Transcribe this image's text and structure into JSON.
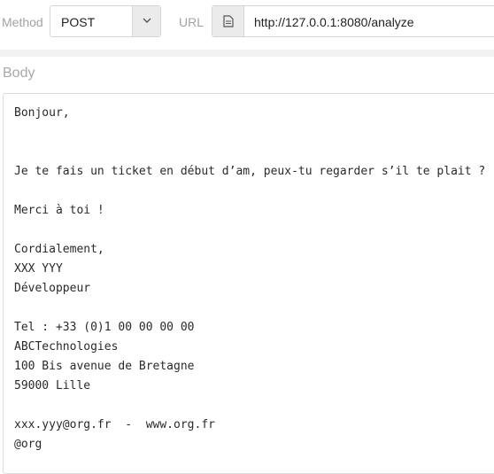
{
  "request": {
    "method_label": "Method",
    "method_value": "POST",
    "url_label": "URL",
    "url_value": "http://127.0.0.1:8080/analyze"
  },
  "body": {
    "label": "Body",
    "text": "Bonjour,\n\n\nJe te fais un ticket en début d’am, peux-tu regarder s’il te plait ?\n\nMerci à toi !\n\nCordialement,\nXXX YYY\nDéveloppeur\n\nTel : +33 (0)1 00 00 00 00\nABCTechnologies\n100 Bis avenue de Bretagne\n59000 Lille\n\nxxx.yyy@org.fr  -  www.org.fr\n@org"
  },
  "icons": {
    "caret": "chevron-down-icon",
    "url": "document-icon"
  },
  "colors": {
    "border": "#d6d6d6",
    "icon_bg": "#ebebeb",
    "label_gray": "#a3a3a3"
  }
}
